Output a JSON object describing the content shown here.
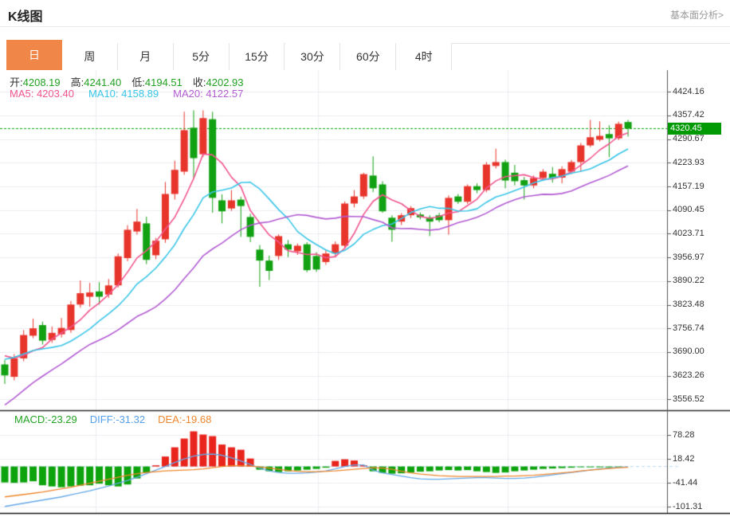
{
  "header": {
    "title": "K线图",
    "link": "基本面分析>"
  },
  "tabs": {
    "active_index": 0,
    "active_bg": "#f08647",
    "items": [
      "日",
      "周",
      "月",
      "5分",
      "15分",
      "30分",
      "60分",
      "4时"
    ]
  },
  "ohlc": {
    "o_label": "开:",
    "o_value": "4208.19",
    "h_label": "高:",
    "h_value": "4241.40",
    "l_label": "低:",
    "l_value": "4194.51",
    "c_label": "收:",
    "c_value": "4202.93"
  },
  "ma_legend": [
    {
      "label": "MA5: ",
      "value": "4203.40",
      "color": "#f2548e"
    },
    {
      "label": "MA10: ",
      "value": "4158.89",
      "color": "#38c5e8"
    },
    {
      "label": "MA20: ",
      "value": "4122.57",
      "color": "#b25bd2"
    }
  ],
  "macd_legend": [
    {
      "label": "MACD:",
      "value": "-23.29",
      "color": "#23a323"
    },
    {
      "label": "DIFF:",
      "value": "-31.32",
      "color": "#55a0ea"
    },
    {
      "label": "DEA:",
      "value": "-19.68",
      "color": "#f2862d"
    }
  ],
  "last_price": {
    "value": "4320.45"
  },
  "chart_data": {
    "type": "candlestick+macd",
    "price_axis_ticks": [
      "4424.16",
      "4357.42",
      "4290.67",
      "4223.93",
      "4157.19",
      "4090.45",
      "4023.71",
      "3956.97",
      "3890.22",
      "3823.48",
      "3756.74",
      "3690.00",
      "3623.26",
      "3556.52"
    ],
    "macd_axis_ticks": [
      "78.28",
      "18.42",
      "-41.44",
      "-101.31"
    ],
    "dotted_price": 4320.45,
    "grid_x": [
      120,
      399,
      637
    ],
    "candles": [
      [
        3655,
        3668,
        3600,
        3624
      ],
      [
        3620,
        3684,
        3610,
        3672
      ],
      [
        3672,
        3752,
        3664,
        3738
      ],
      [
        3736,
        3784,
        3729,
        3757
      ],
      [
        3766,
        3776,
        3711,
        3722
      ],
      [
        3724,
        3762,
        3716,
        3744
      ],
      [
        3740,
        3786,
        3731,
        3758
      ],
      [
        3752,
        3834,
        3744,
        3824
      ],
      [
        3824,
        3892,
        3815,
        3856
      ],
      [
        3846,
        3885,
        3818,
        3858
      ],
      [
        3861,
        3887,
        3824,
        3846
      ],
      [
        3852,
        3896,
        3843,
        3878
      ],
      [
        3878,
        3968,
        3872,
        3960
      ],
      [
        3955,
        4048,
        3946,
        4035
      ],
      [
        4030,
        4094,
        4021,
        4058
      ],
      [
        4053,
        4072,
        3938,
        3950
      ],
      [
        3963,
        4012,
        3952,
        4004
      ],
      [
        4008,
        4170,
        3998,
        4136
      ],
      [
        4136,
        4230,
        4120,
        4204
      ],
      [
        4199,
        4368,
        4190,
        4316
      ],
      [
        4323,
        4372,
        4181,
        4237
      ],
      [
        4248,
        4372,
        4240,
        4350
      ],
      [
        4347,
        4368,
        4083,
        4125
      ],
      [
        4118,
        4135,
        4053,
        4087
      ],
      [
        4095,
        4147,
        4088,
        4118
      ],
      [
        4120,
        4128,
        4015,
        4102
      ],
      [
        4071,
        4080,
        4000,
        4015
      ],
      [
        3979,
        3992,
        3874,
        3948
      ],
      [
        3948,
        3962,
        3893,
        3919
      ],
      [
        3961,
        4022,
        3950,
        4017
      ],
      [
        3994,
        4006,
        3958,
        3979
      ],
      [
        3974,
        3996,
        3964,
        3990
      ],
      [
        3994,
        4000,
        3915,
        3921
      ],
      [
        3961,
        3972,
        3916,
        3923
      ],
      [
        3944,
        3978,
        3936,
        3968
      ],
      [
        3968,
        4002,
        3958,
        3994
      ],
      [
        3990,
        4115,
        3984,
        4109
      ],
      [
        4109,
        4147,
        4098,
        4129
      ],
      [
        4129,
        4196,
        4122,
        4192
      ],
      [
        4188,
        4242,
        4141,
        4152
      ],
      [
        4163,
        4172,
        4083,
        4087
      ],
      [
        4069,
        4076,
        4001,
        4035
      ],
      [
        4058,
        4082,
        4048,
        4076
      ],
      [
        4076,
        4102,
        4068,
        4096
      ],
      [
        4078,
        4084,
        4064,
        4070
      ],
      [
        4070,
        4076,
        4017,
        4058
      ],
      [
        4076,
        4083,
        4056,
        4062
      ],
      [
        4062,
        4132,
        4021,
        4125
      ],
      [
        4129,
        4136,
        4108,
        4114
      ],
      [
        4114,
        4163,
        4108,
        4158
      ],
      [
        4158,
        4166,
        4138,
        4147
      ],
      [
        4147,
        4226,
        4141,
        4219
      ],
      [
        4215,
        4264,
        4208,
        4226
      ],
      [
        4226,
        4233,
        4152,
        4174
      ],
      [
        4196,
        4218,
        4160,
        4172
      ],
      [
        4175,
        4184,
        4120,
        4160
      ],
      [
        4160,
        4188,
        4152,
        4181
      ],
      [
        4181,
        4206,
        4176,
        4199
      ],
      [
        4193,
        4212,
        4168,
        4182
      ],
      [
        4182,
        4214,
        4166,
        4206
      ],
      [
        4199,
        4232,
        4192,
        4226
      ],
      [
        4226,
        4280,
        4199,
        4273
      ],
      [
        4273,
        4345,
        4268,
        4296
      ],
      [
        4289,
        4341,
        4284,
        4300
      ],
      [
        4305,
        4330,
        4240,
        4293
      ],
      [
        4293,
        4340,
        4288,
        4334
      ],
      [
        4339,
        4345,
        4298,
        4320.45
      ]
    ],
    "ma_periods": [
      5,
      10,
      20
    ],
    "ma_seed_closes": [
      3240,
      3270,
      3300,
      3330,
      3360,
      3390,
      3420,
      3450,
      3480,
      3510,
      3600,
      3620,
      3640,
      3660,
      3680,
      3700,
      3705,
      3700,
      3690,
      3678
    ],
    "macd": {
      "diff": [
        -100,
        -96,
        -92,
        -88,
        -84,
        -80,
        -76,
        -71,
        -66,
        -61,
        -55,
        -49,
        -42,
        -35,
        -27,
        -18,
        -9,
        0,
        10,
        19,
        26,
        30,
        31,
        28,
        22,
        14,
        5,
        -4,
        -11,
        -15,
        -17,
        -17,
        -16,
        -14,
        -11,
        -6,
        0,
        4,
        4,
        -9,
        -16,
        -20,
        -24,
        -28,
        -31,
        -32,
        -32,
        -31,
        -30,
        -29,
        -28,
        -28,
        -29,
        -30,
        -30,
        -29,
        -27,
        -24,
        -21,
        -18,
        -15,
        -12,
        -9,
        -6,
        -4,
        -2,
        -1
      ],
      "dea": [
        -76,
        -73,
        -70,
        -67,
        -64,
        -60,
        -56,
        -52,
        -47,
        -42,
        -37,
        -32,
        -27,
        -22,
        -18,
        -15,
        -13,
        -11,
        -10,
        -9,
        -8,
        -6,
        -3,
        0,
        2,
        2,
        1,
        -1,
        -4,
        -7,
        -10,
        -12,
        -13,
        -13,
        -12,
        -11,
        -9,
        -7,
        -5,
        -3,
        -4,
        -7,
        -12,
        -16,
        -19,
        -21,
        -23,
        -24,
        -25,
        -25,
        -25,
        -25,
        -25,
        -24,
        -24,
        -23,
        -22,
        -20,
        -18,
        -16,
        -14,
        -11,
        -9,
        -7,
        -5,
        -3,
        -2
      ],
      "hist": [
        -40,
        -41,
        -40,
        -37,
        -47,
        -50,
        -52,
        -50,
        -48,
        -47,
        -43,
        -47,
        -50,
        -45,
        -30,
        -15,
        3,
        25,
        48,
        70,
        88,
        80,
        76,
        55,
        48,
        42,
        20,
        -8,
        -12,
        -14,
        -12,
        -10,
        -8,
        -6,
        -3,
        14,
        18,
        15,
        3,
        -12,
        -16,
        -18,
        -17,
        -15,
        -13,
        -12,
        -10,
        -9,
        -10,
        -9,
        -12,
        -14,
        -16,
        -15,
        -12,
        -10,
        -8,
        -6,
        -5,
        -4,
        -3,
        -2,
        -2,
        -1,
        -1,
        -0.5,
        0
      ]
    },
    "colors": {
      "up": "#e8352c",
      "down": "#12a112",
      "ma5": "#f2548e",
      "ma10": "#38c5e8",
      "ma20": "#b25bd2",
      "hist_pos": "#e8241c",
      "hist_neg": "#0da30d",
      "diff_line": "#64a8e8",
      "dea_line": "#f0862a",
      "grid": "#ececf2",
      "axis": "#555555",
      "border": "#2b2b2b",
      "dotted": "#00a404",
      "zero_dash": "#b9d9f5",
      "tag_bg": "#019a05"
    }
  }
}
